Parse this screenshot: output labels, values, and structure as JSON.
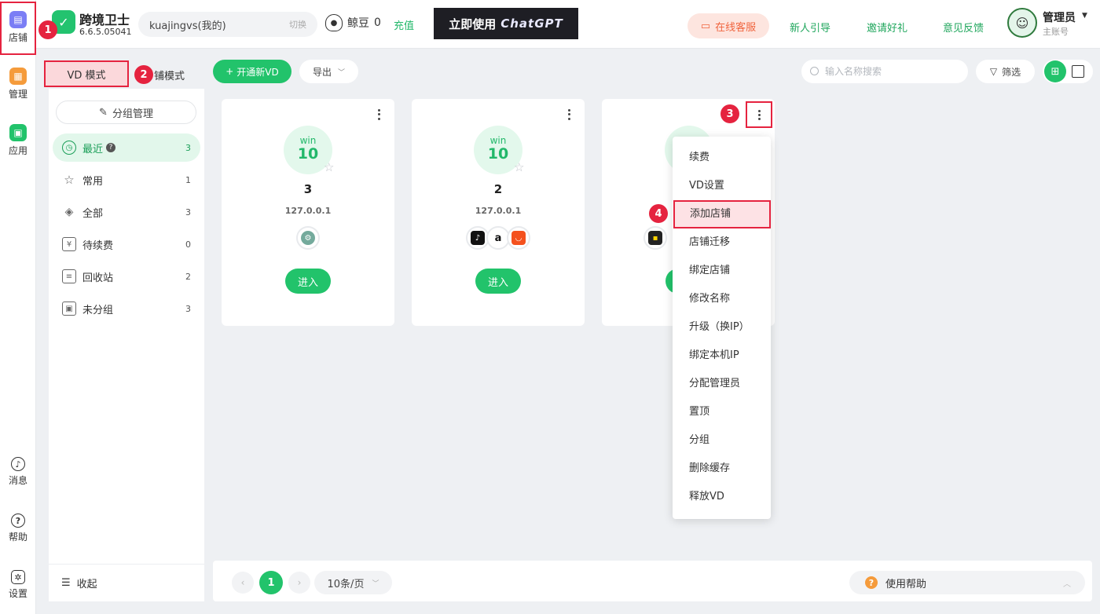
{
  "rail": {
    "shop": "店铺",
    "manage": "管理",
    "app": "应用",
    "message": "消息",
    "help": "帮助",
    "settings": "设置"
  },
  "brand": {
    "name": "跨境卫士",
    "version": "6.6.5.05041"
  },
  "account": {
    "name": "kuajingvs(我的)",
    "switch_label": "切换"
  },
  "coins": {
    "label": "鲸豆",
    "value": "0"
  },
  "recharge_label": "充值",
  "banner": {
    "prefix": "立即使用",
    "product": "ChatGPT"
  },
  "header_links": {
    "customer_service": "在线客服",
    "guide": "新人引导",
    "invite": "邀请好礼",
    "feedback": "意见反馈"
  },
  "user": {
    "name": "管理员",
    "role": "主账号"
  },
  "modes": {
    "vd": "VD 模式",
    "shop": "铺模式"
  },
  "group_manage": "分组管理",
  "nav": [
    {
      "label": "最近",
      "count": "3",
      "icon": "clock-icon"
    },
    {
      "label": "常用",
      "count": "1",
      "icon": "star-icon"
    },
    {
      "label": "全部",
      "count": "3",
      "icon": "layers-icon"
    },
    {
      "label": "待续费",
      "count": "0",
      "icon": "renew-icon"
    },
    {
      "label": "回收站",
      "count": "2",
      "icon": "trash-icon"
    },
    {
      "label": "未分组",
      "count": "3",
      "icon": "folder-icon"
    }
  ],
  "collapse_label": "收起",
  "toolbar": {
    "new_vd": "开通新VD",
    "export": "导出",
    "search_placeholder": "输入名称搜索",
    "filter": "筛选"
  },
  "cards": [
    {
      "os_label": "win",
      "os_version": "10",
      "name": "3",
      "ip": "127.0.0.1",
      "platforms": [
        "chatgpt"
      ],
      "enter": "进入"
    },
    {
      "os_label": "win",
      "os_version": "10",
      "name": "2",
      "ip": "127.0.0.1",
      "platforms": [
        "tiktok",
        "amazon",
        "aliexpress"
      ],
      "enter": "进入"
    },
    {
      "os_label": "",
      "os_version": "",
      "name": "",
      "ip": "",
      "platforms": [
        "shop"
      ],
      "enter": ""
    }
  ],
  "menu": [
    "续费",
    "VD设置",
    "添加店铺",
    "店铺迁移",
    "绑定店铺",
    "修改名称",
    "升级（换IP）",
    "绑定本机IP",
    "分配管理员",
    "置顶",
    "分组",
    "删除缓存",
    "释放VD"
  ],
  "badges": [
    "1",
    "2",
    "3",
    "4"
  ],
  "pagination": {
    "current": "1",
    "page_size": "10条/页"
  },
  "help_label": "使用帮助",
  "colors": {
    "accent": "#22c36b",
    "highlight": "#e5233f"
  }
}
